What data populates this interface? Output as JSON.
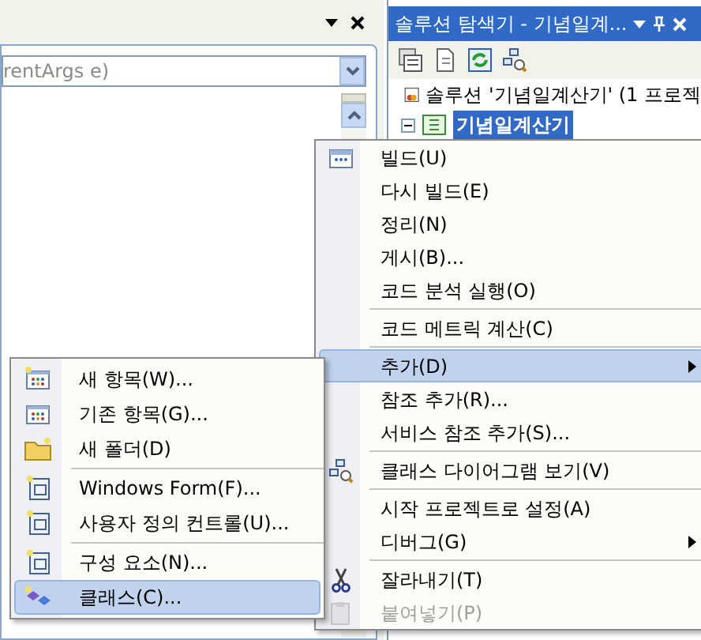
{
  "editor": {
    "method_combo": {
      "value": "rentArgs e)"
    }
  },
  "solution_explorer": {
    "title": "솔루션 탐색기 - 기념일계...",
    "tree": [
      {
        "label": "솔루션 '기념일계산기' (1 프로젝",
        "selected": false,
        "children": [
          {
            "label": "기념일계산기",
            "selected": true,
            "expanded": true
          }
        ]
      }
    ]
  },
  "context_menu": {
    "items": [
      {
        "kind": "item",
        "label": "빌드(U)",
        "has_submenu": false,
        "selected": false,
        "disabled": false
      },
      {
        "kind": "item",
        "label": "다시 빌드(E)",
        "has_submenu": false,
        "selected": false,
        "disabled": false
      },
      {
        "kind": "item",
        "label": "정리(N)",
        "has_submenu": false,
        "selected": false,
        "disabled": false
      },
      {
        "kind": "item",
        "label": "게시(B)...",
        "has_submenu": false,
        "selected": false,
        "disabled": false
      },
      {
        "kind": "item",
        "label": "코드 분석 실행(O)",
        "has_submenu": false,
        "selected": false,
        "disabled": false
      },
      {
        "kind": "separator"
      },
      {
        "kind": "item",
        "label": "코드 메트릭 계산(C)",
        "has_submenu": false,
        "selected": false,
        "disabled": false
      },
      {
        "kind": "separator"
      },
      {
        "kind": "item",
        "label": "추가(D)",
        "has_submenu": true,
        "selected": true,
        "disabled": false
      },
      {
        "kind": "item",
        "label": "참조 추가(R)...",
        "has_submenu": false,
        "selected": false,
        "disabled": false
      },
      {
        "kind": "item",
        "label": "서비스 참조 추가(S)...",
        "has_submenu": false,
        "selected": false,
        "disabled": false
      },
      {
        "kind": "separator"
      },
      {
        "kind": "item",
        "label": "클래스 다이어그램 보기(V)",
        "has_submenu": false,
        "selected": false,
        "disabled": false
      },
      {
        "kind": "separator"
      },
      {
        "kind": "item",
        "label": "시작 프로젝트로 설정(A)",
        "has_submenu": false,
        "selected": false,
        "disabled": false
      },
      {
        "kind": "item",
        "label": "디버그(G)",
        "has_submenu": true,
        "selected": false,
        "disabled": false
      },
      {
        "kind": "separator"
      },
      {
        "kind": "item",
        "label": "잘라내기(T)",
        "has_submenu": false,
        "selected": false,
        "disabled": false
      },
      {
        "kind": "item",
        "label": "붙여넣기(P)",
        "has_submenu": false,
        "selected": false,
        "disabled": true
      }
    ]
  },
  "add_submenu": {
    "items": [
      {
        "kind": "item",
        "label": "새 항목(W)...",
        "selected": false
      },
      {
        "kind": "item",
        "label": "기존 항목(G)...",
        "selected": false
      },
      {
        "kind": "item",
        "label": "새 폴더(D)",
        "selected": false
      },
      {
        "kind": "separator"
      },
      {
        "kind": "item",
        "label": "Windows Form(F)...",
        "selected": false
      },
      {
        "kind": "item",
        "label": "사용자 정의 컨트롤(U)...",
        "selected": false
      },
      {
        "kind": "separator"
      },
      {
        "kind": "item",
        "label": "구성 요소(N)...",
        "selected": false
      },
      {
        "kind": "item",
        "label": "클래스(C)...",
        "selected": true
      }
    ]
  }
}
